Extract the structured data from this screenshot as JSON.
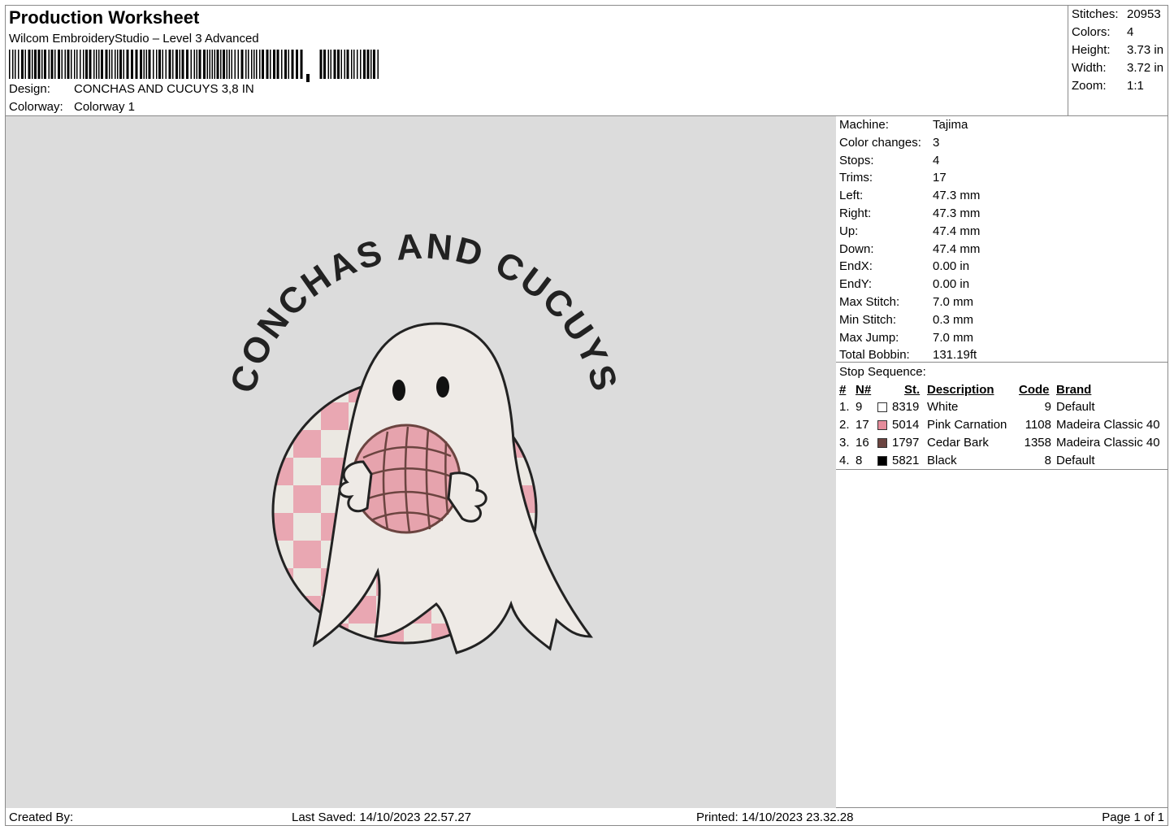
{
  "header": {
    "title": "Production Worksheet",
    "software": "Wilcom EmbroideryStudio – Level 3 Advanced",
    "design_label": "Design:",
    "design_value": "CONCHAS AND CUCUYS 3,8 IN",
    "colorway_label": "Colorway:",
    "colorway_value": "Colorway 1"
  },
  "summary": [
    {
      "k": "Stitches:",
      "v": "20953"
    },
    {
      "k": "Colors:",
      "v": "4"
    },
    {
      "k": "Height:",
      "v": "3.73 in"
    },
    {
      "k": "Width:",
      "v": "3.72 in"
    },
    {
      "k": "Zoom:",
      "v": "1:1"
    }
  ],
  "machine_info": [
    {
      "k": "Machine:",
      "v": "Tajima"
    },
    {
      "k": "Color changes:",
      "v": "3"
    },
    {
      "k": "Stops:",
      "v": "4"
    },
    {
      "k": "Trims:",
      "v": "17"
    },
    {
      "k": "Left:",
      "v": "47.3 mm"
    },
    {
      "k": "Right:",
      "v": "47.3 mm"
    },
    {
      "k": "Up:",
      "v": "47.4 mm"
    },
    {
      "k": "Down:",
      "v": "47.4 mm"
    },
    {
      "k": "EndX:",
      "v": "0.00 in"
    },
    {
      "k": "EndY:",
      "v": "0.00 in"
    },
    {
      "k": "Max Stitch:",
      "v": "7.0 mm"
    },
    {
      "k": "Min Stitch:",
      "v": "0.3 mm"
    },
    {
      "k": "Max Jump:",
      "v": "7.0 mm"
    },
    {
      "k": "Total Bobbin:",
      "v": "131.19ft"
    }
  ],
  "stop_sequence": {
    "label": "Stop Sequence:",
    "headers": {
      "num": "#",
      "n": "N#",
      "st": "St.",
      "desc": "Description",
      "code": "Code",
      "brand": "Brand"
    },
    "rows": [
      {
        "num": "1.",
        "n": "9",
        "color": "#ffffff",
        "st": "8319",
        "desc": "White",
        "code": "9",
        "brand": "Default"
      },
      {
        "num": "2.",
        "n": "17",
        "color": "#e58c9b",
        "st": "5014",
        "desc": "Pink Carnation",
        "code": "1108",
        "brand": "Madeira Classic 40"
      },
      {
        "num": "3.",
        "n": "16",
        "color": "#6b4440",
        "st": "1797",
        "desc": "Cedar Bark",
        "code": "1358",
        "brand": "Madeira Classic 40"
      },
      {
        "num": "4.",
        "n": "8",
        "color": "#000000",
        "st": "5821",
        "desc": "Black",
        "code": "8",
        "brand": "Default"
      }
    ]
  },
  "design_art": {
    "text": "CONCHAS AND CUCUYS",
    "colors": {
      "fabric": "#dcdcdc",
      "ghost": "#eeeae6",
      "pink": "#e9a7b2",
      "cream": "#ebe8e2",
      "concha": "#e6a3ad",
      "concha_line": "#6b4440",
      "outline": "#222222"
    }
  },
  "footer": {
    "created_by": "Created By:",
    "last_saved": "Last Saved: 14/10/2023 22.57.27",
    "printed": "Printed: 14/10/2023 23.32.28",
    "page": "Page 1 of 1"
  }
}
